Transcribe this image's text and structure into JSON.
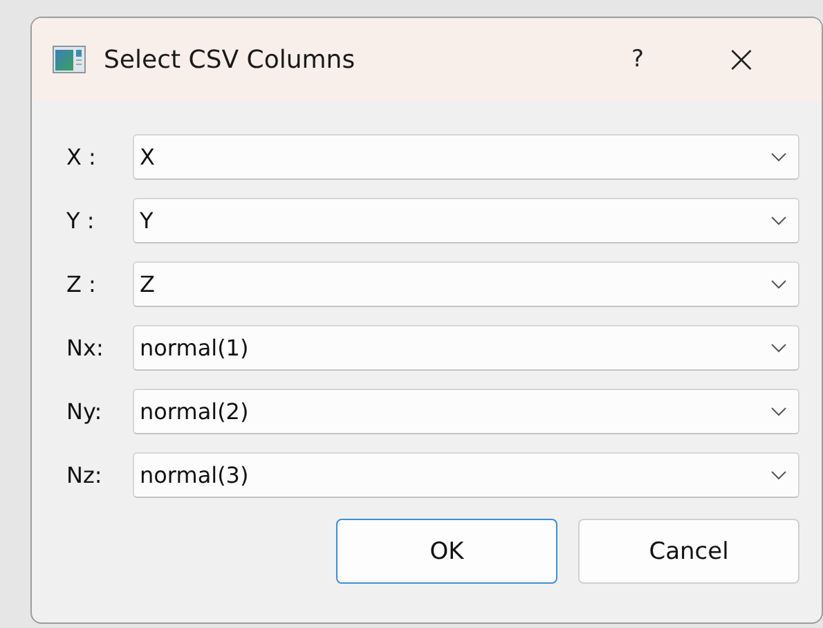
{
  "window": {
    "title": "Select CSV Columns",
    "help": "?",
    "close": "×"
  },
  "fields": [
    {
      "label": "X :",
      "value": "X"
    },
    {
      "label": "Y :",
      "value": "Y"
    },
    {
      "label": "Z :",
      "value": "Z"
    },
    {
      "label": "Nx:",
      "value": "normal(1)"
    },
    {
      "label": "Ny:",
      "value": "normal(2)"
    },
    {
      "label": "Nz:",
      "value": "normal(3)"
    }
  ],
  "buttons": [
    {
      "label": "OK",
      "default": true
    },
    {
      "label": "Cancel",
      "default": false
    }
  ]
}
